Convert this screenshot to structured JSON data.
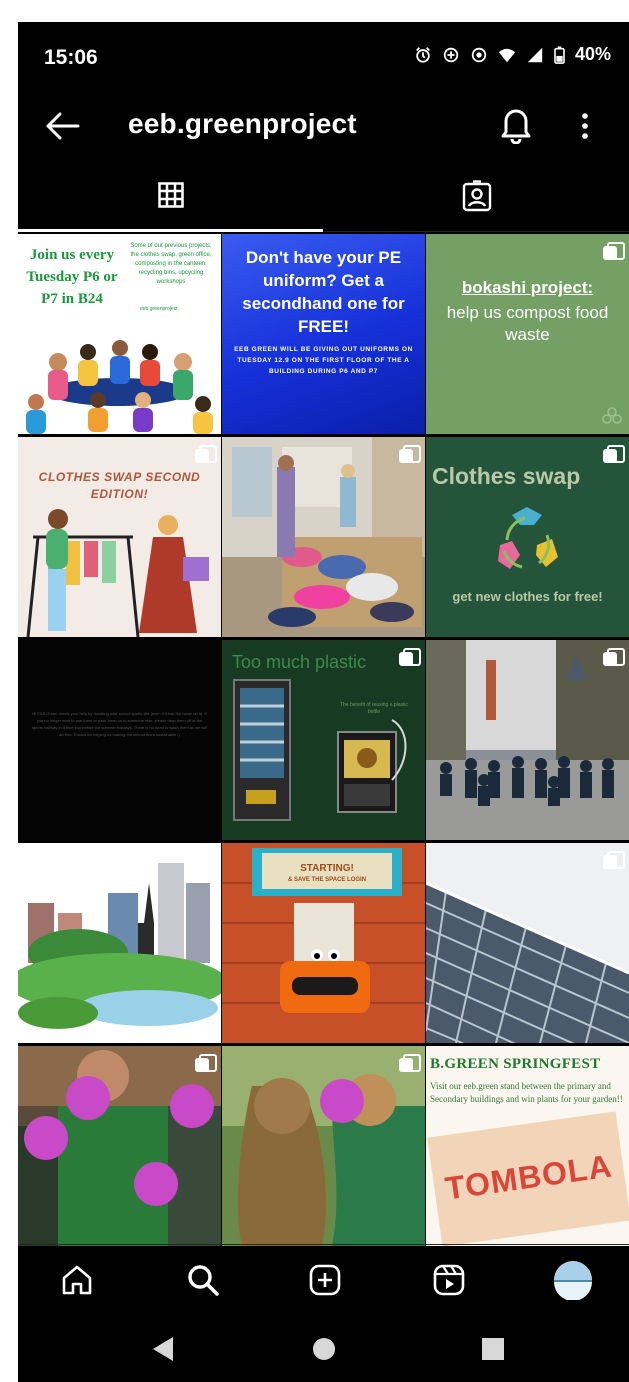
{
  "status_bar": {
    "time": "15:06",
    "battery": "40%",
    "icons": [
      "alarm-icon",
      "data-saver-icon",
      "vpn-icon",
      "wifi-icon",
      "signal-icon",
      "battery-icon"
    ]
  },
  "header": {
    "username": "eeb.greenproject",
    "back_icon": "arrow-left-icon",
    "notification_icon": "bell-icon",
    "more_icon": "more-vertical-icon"
  },
  "tabs": [
    {
      "name": "posts-grid",
      "icon": "grid-icon",
      "selected": true
    },
    {
      "name": "tagged",
      "icon": "tagged-person-icon",
      "selected": false
    }
  ],
  "posts": {
    "p1": {
      "title": "Join us every Tuesday P6 or P7 in B24",
      "small": "Some of our previous projects: the clothes swap, green office, composting in the canteen, recycling bins, upcycling workshops",
      "handle": "eeb.greenproject"
    },
    "p2": {
      "title": "Don't have your PE uniform? Get a secondhand one for FREE!",
      "subtitle": "EEB GREEN WILL BE GIVING OUT UNIFORMS ON TUESDAY 12.9 ON THE FIRST FLOOR OF THE A BUILDING DURING P6 AND P7"
    },
    "p3": {
      "underlined": "bokashi project:",
      "text": "help us compost food waste"
    },
    "p4": {
      "text": "CLOTHES SWAP SECOND EDITION!"
    },
    "p6": {
      "title": "Clothes swap",
      "subtitle": "get new clothes for free!"
    },
    "p7": {
      "text": "Hi EEB Green needs your help by donating your school sports kits (even if it has the name on it). If you no longer wish to use them or pass them on to someone else, please drop them off at the sports hallway in a blue box before the summer holidays. There is no need to wash them as we will do this. Thanks for helping us making the school more sustainable :)"
    },
    "p8": {
      "title": "Too much plastic",
      "caption": "The benefit of reusing a plastic bottle"
    },
    "p11": {
      "sign_line1": "STARTING!",
      "sign_line2": "& SAVE THE SPACE LOGIN"
    },
    "p15": {
      "title": "B.GREEN SPRINGFEST",
      "subtitle": "Visit our eeb.green stand between the primary and Secondary buildings and win plants for your garden!!",
      "ticket": "TOMBOLA"
    }
  },
  "bottom_nav": [
    {
      "name": "home",
      "icon": "home-icon"
    },
    {
      "name": "search",
      "icon": "search-icon"
    },
    {
      "name": "create",
      "icon": "plus-square-icon"
    },
    {
      "name": "reels",
      "icon": "reels-icon"
    },
    {
      "name": "profile",
      "icon": "avatar-icon"
    }
  ],
  "system_nav": [
    "back-triangle-icon",
    "home-circle-icon",
    "recents-square-icon"
  ],
  "colors": {
    "background": "#000000",
    "text": "#ffffff",
    "post_green": "#74a065",
    "post_blue": "#1530d8"
  }
}
